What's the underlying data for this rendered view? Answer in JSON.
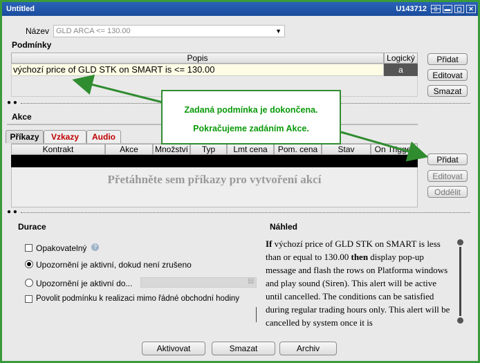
{
  "window": {
    "title": "Untitled",
    "account": "U143712",
    "controls": [
      "⊣⊢",
      "▬",
      "◻",
      "✕"
    ]
  },
  "name_field": {
    "label": "Název",
    "value": "GLD ARCA <= 130.00"
  },
  "conditions": {
    "heading": "Podmínky",
    "columns": [
      "Popis",
      "Logický"
    ],
    "rows": [
      {
        "description": "výchozí price of GLD STK on SMART is <= 130.00",
        "logic": "a"
      }
    ],
    "buttons": {
      "add": "Přidat",
      "edit": "Editovat",
      "delete": "Smazat"
    }
  },
  "actions": {
    "heading": "Akce",
    "tabs": [
      "Příkazy",
      "Vzkazy",
      "Audio"
    ],
    "columns": [
      "Kontrakt",
      "Akce",
      "Množství",
      "Typ",
      "Lmt cena",
      "Pom. cena",
      "Stav",
      "On Trigger"
    ],
    "empty_text": "Přetáhněte sem příkazy pro vytvoření akcí",
    "buttons": {
      "add": "Přidat",
      "edit": "Editovat",
      "split": "Oddělit"
    }
  },
  "callout": {
    "line1": "Zadaná podmínka je dokončena.",
    "line2": "Pokračujeme zadáním Akce."
  },
  "duration": {
    "heading": "Durace",
    "repeatable": "Opakovatelný",
    "opt_until_cancel": "Upozornění je aktivní, dokud není zrušeno",
    "opt_until_date": "Upozornění je aktivní do...",
    "outside_rth": "Povolit podmínku k realizaci mimo řádné obchodní hodiny"
  },
  "preview": {
    "heading": "Náhled",
    "if_word": "If",
    "condition_text": " výchozí price of GLD STK on SMART is less than or equal to 130.00 ",
    "then_word": "then",
    "rest_text": " display pop-up message and flash the rows on Platforma windows and play sound (Siren). This alert will be active until cancelled. The conditions can be satisfied during regular trading hours only. This alert will be cancelled by system once it is"
  },
  "footer": {
    "activate": "Aktivovat",
    "delete": "Smazat",
    "archive": "Archiv"
  },
  "colors": {
    "accent_green": "#2f8c2f",
    "title_blue": "#1a4c9c",
    "tab_red": "#c00000"
  }
}
